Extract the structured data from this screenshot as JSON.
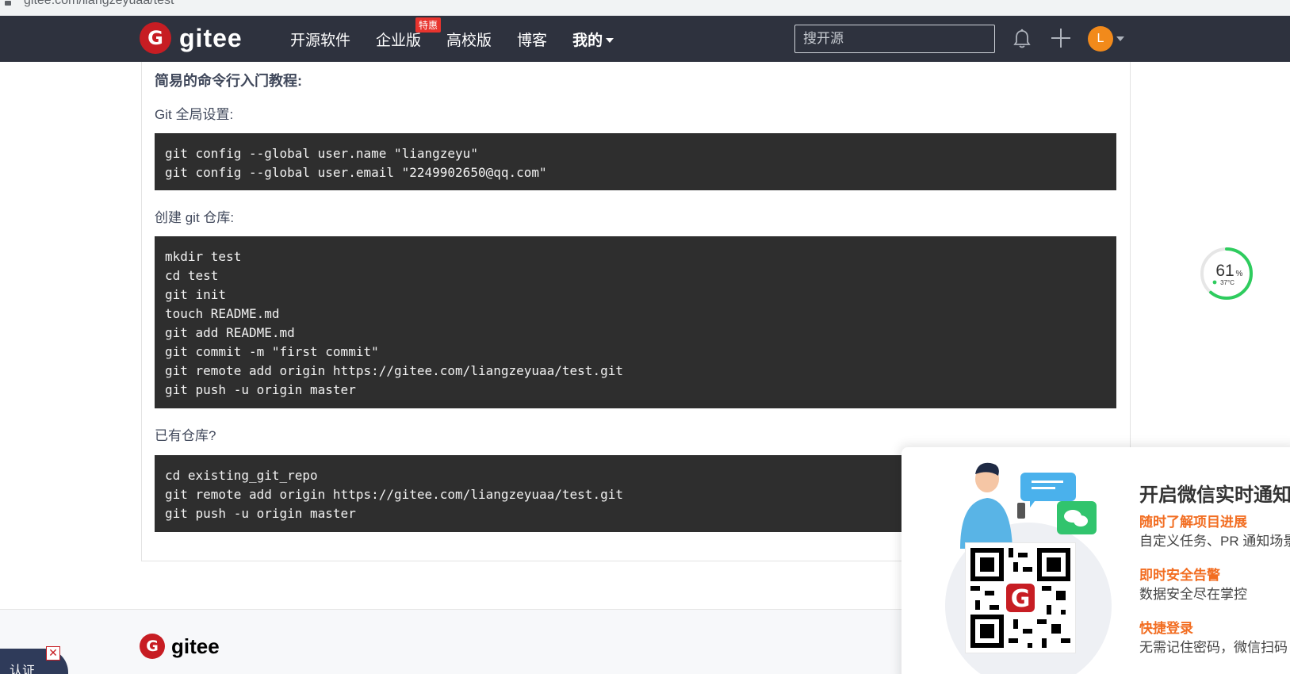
{
  "browser": {
    "url": "gitee.com/liangzeyuaa/test"
  },
  "header": {
    "logo_glyph": "G",
    "brand": "gitee",
    "nav": [
      {
        "label": "开源软件"
      },
      {
        "label": "企业版",
        "badge": "特惠"
      },
      {
        "label": "高校版"
      },
      {
        "label": "博客"
      },
      {
        "label": "我的"
      }
    ],
    "search_placeholder": "搜开源",
    "avatar_letter": "L"
  },
  "content": {
    "heading": "简易的命令行入门教程:",
    "sections": [
      {
        "label": "Git 全局设置:",
        "code": "git config --global user.name \"liangzeyu\"\ngit config --global user.email \"2249902650@qq.com\""
      },
      {
        "label": "创建 git 仓库:",
        "code": "mkdir test\ncd test\ngit init\ntouch README.md\ngit add README.md\ngit commit -m \"first commit\"\ngit remote add origin https://gitee.com/liangzeyuaa/test.git\ngit push -u origin master"
      },
      {
        "label": "已有仓库?",
        "code": "cd existing_git_repo\ngit remote add origin https://gitee.com/liangzeyuaa/test.git\ngit push -u origin master"
      }
    ]
  },
  "gauge": {
    "value": "61",
    "unit": "%",
    "temp": "37°C",
    "fraction": 0.61,
    "color": "#2ecc5e"
  },
  "footer": {
    "logo_glyph": "G",
    "brand": "gitee"
  },
  "floating_tab": {
    "text": "认证",
    "close": "✕"
  },
  "wechat_popup": {
    "title": "开启微信实时通知",
    "features": [
      {
        "title": "随时了解项目进展",
        "desc": "自定义任务、PR 通知场景"
      },
      {
        "title": "即时安全告警",
        "desc": "数据安全尽在掌控"
      },
      {
        "title": "快捷登录",
        "desc": "无需记住密码，微信扫码"
      }
    ],
    "qr_logo_glyph": "G"
  },
  "colors": {
    "header_bg": "#2e323e",
    "brand_red": "#c71d23",
    "accent_orange": "#f26d21",
    "code_bg": "#2e2e2e"
  }
}
